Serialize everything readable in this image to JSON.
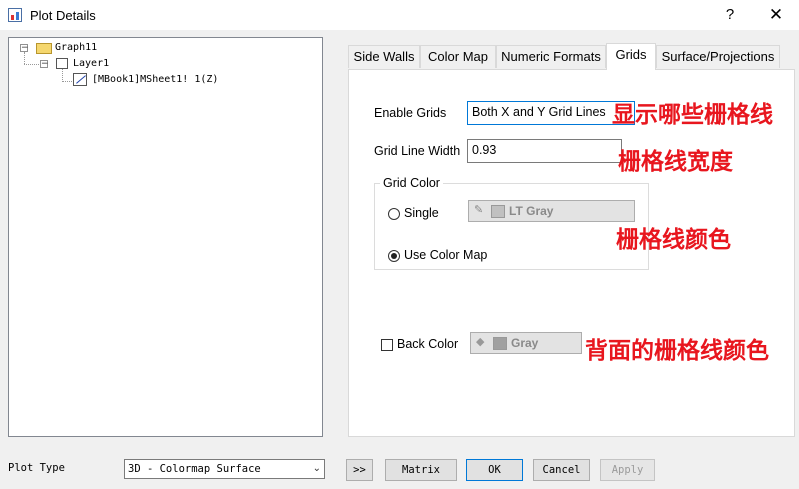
{
  "window": {
    "title": "Plot Details",
    "help_glyph": "?",
    "close_glyph": "✕"
  },
  "tree": {
    "graph": "Graph11",
    "layer": "Layer1",
    "plot": "[MBook1]MSheet1! 1(Z)",
    "collapse_glyph": "−"
  },
  "tabs": [
    {
      "label": "Side Walls"
    },
    {
      "label": "Color Map"
    },
    {
      "label": "Numeric Formats"
    },
    {
      "label": "Grids",
      "active": true
    },
    {
      "label": "Surface/Projections"
    }
  ],
  "grids": {
    "enable_label": "Enable Grids",
    "enable_value": "Both X and Y Grid Lines",
    "width_label": "Grid Line Width",
    "width_value": "0.93",
    "color_group_label": "Grid Color",
    "single_label": "Single",
    "single_checked": false,
    "single_color_name": "LT Gray",
    "single_color_hex": "#c0c0c0",
    "use_colormap_label": "Use Color Map",
    "use_colormap_checked": true,
    "back_color_label": "Back Color",
    "back_color_checked": false,
    "back_color_name": "Gray",
    "back_color_hex": "#808080"
  },
  "annotations": {
    "enable": "显示哪些栅格线",
    "width": "栅格线宽度",
    "color": "栅格线颜色",
    "back": "背面的栅格线颜色",
    "color_hex": "#e8161e"
  },
  "bottom": {
    "plot_type_label": "Plot Type",
    "plot_type_value": "3D - Colormap Surface",
    "expand_label": ">>",
    "matrix_label": "Matrix",
    "ok_label": "OK",
    "cancel_label": "Cancel",
    "apply_label": "Apply"
  }
}
